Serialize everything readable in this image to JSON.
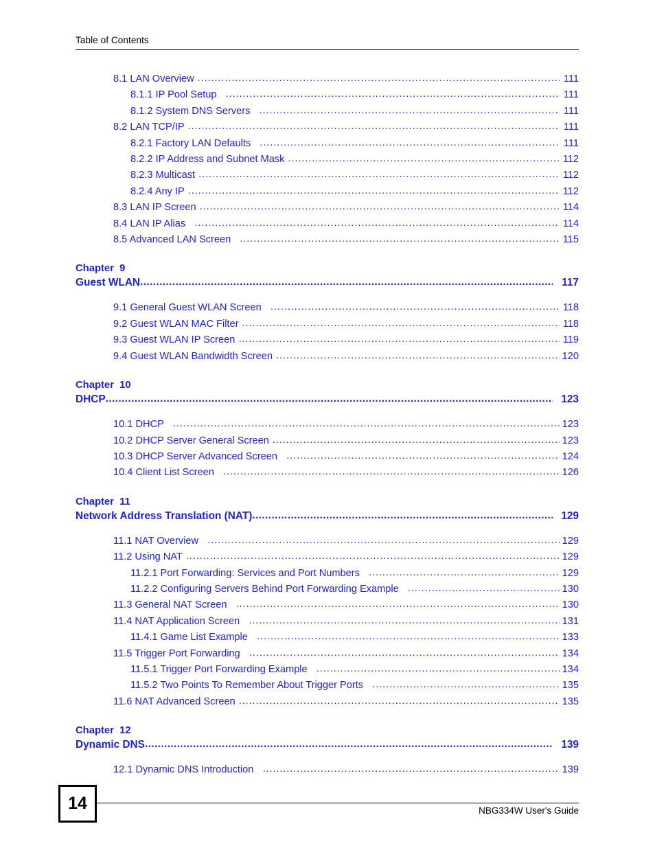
{
  "header": {
    "title": "Table of Contents"
  },
  "dot_leader": "..............................................................................................................................................................................",
  "colors": {
    "toc_blue": "#2222d6",
    "text_black": "#000000"
  },
  "toc": {
    "section_8": [
      {
        "label": "8.1 LAN Overview",
        "page": "111",
        "level": 1,
        "gap": "sm"
      },
      {
        "label": "8.1.1 IP Pool Setup",
        "page": "111",
        "level": 2,
        "gap": "md"
      },
      {
        "label": "8.1.2 System DNS Servers",
        "page": "111",
        "level": 2,
        "gap": "md"
      },
      {
        "label": "8.2 LAN TCP/IP",
        "page": "111",
        "level": 1,
        "gap": "sm"
      },
      {
        "label": "8.2.1 Factory LAN Defaults",
        "page": "111",
        "level": 2,
        "gap": "md"
      },
      {
        "label": "8.2.2 IP Address and Subnet Mask",
        "page": "112",
        "level": 2,
        "gap": "sm"
      },
      {
        "label": "8.2.3 Multicast",
        "page": "112",
        "level": 2,
        "gap": "sm"
      },
      {
        "label": "8.2.4 Any IP",
        "page": "112",
        "level": 2,
        "gap": "sm"
      },
      {
        "label": "8.3 LAN IP Screen",
        "page": "114",
        "level": 1,
        "gap": "sm"
      },
      {
        "label": "8.4 LAN IP Alias",
        "page": "114",
        "level": 1,
        "gap": "md"
      },
      {
        "label": "8.5 Advanced LAN Screen",
        "page": "115",
        "level": 1,
        "gap": "md"
      }
    ],
    "chapter_9": {
      "number": "Chapter  9",
      "title": "Guest WLAN",
      "page": "117",
      "entries": [
        {
          "label": "9.1 General Guest WLAN Screen",
          "page": "118",
          "level": 1,
          "gap": "md"
        },
        {
          "label": "9.2 Guest WLAN MAC Filter",
          "page": "118",
          "level": 1,
          "gap": "sm"
        },
        {
          "label": "9.3 Guest WLAN IP Screen",
          "page": "119",
          "level": 1,
          "gap": "sm"
        },
        {
          "label": "9.4 Guest WLAN Bandwidth Screen",
          "page": "120",
          "level": 1,
          "gap": "sm"
        }
      ]
    },
    "chapter_10": {
      "number": "Chapter  10",
      "title": "DHCP",
      "page": "123",
      "entries": [
        {
          "label": "10.1 DHCP",
          "page": "123",
          "level": 1,
          "gap": "md"
        },
        {
          "label": "10.2 DHCP Server General Screen",
          "page": "123",
          "level": 1,
          "gap": "sm"
        },
        {
          "label": "10.3 DHCP Server Advanced Screen",
          "page": "124",
          "level": 1,
          "gap": "md"
        },
        {
          "label": "10.4 Client List Screen",
          "page": "126",
          "level": 1,
          "gap": "md"
        }
      ]
    },
    "chapter_11": {
      "number": "Chapter  11",
      "title": "Network Address Translation (NAT)",
      "page": "129",
      "entries": [
        {
          "label": "11.1 NAT Overview",
          "page": "129",
          "level": 1,
          "gap": "md"
        },
        {
          "label": "11.2 Using NAT",
          "page": "129",
          "level": 1,
          "gap": "sm"
        },
        {
          "label": "11.2.1 Port Forwarding: Services and Port Numbers",
          "page": "129",
          "level": 2,
          "gap": "md"
        },
        {
          "label": "11.2.2 Configuring Servers Behind Port Forwarding Example",
          "page": "130",
          "level": 2,
          "gap": "md"
        },
        {
          "label": "11.3 General NAT Screen",
          "page": "130",
          "level": 1,
          "gap": "md"
        },
        {
          "label": "11.4 NAT Application Screen",
          "page": "131",
          "level": 1,
          "gap": "md"
        },
        {
          "label": "11.4.1 Game List Example",
          "page": "133",
          "level": 2,
          "gap": "md"
        },
        {
          "label": "11.5 Trigger Port Forwarding",
          "page": "134",
          "level": 1,
          "gap": "md"
        },
        {
          "label": "11.5.1 Trigger Port Forwarding Example",
          "page": "134",
          "level": 2,
          "gap": "md"
        },
        {
          "label": "11.5.2 Two Points To Remember About Trigger Ports",
          "page": "135",
          "level": 2,
          "gap": "md"
        },
        {
          "label": "11.6 NAT Advanced Screen",
          "page": "135",
          "level": 1,
          "gap": "sm"
        }
      ]
    },
    "chapter_12": {
      "number": "Chapter  12",
      "title": "Dynamic DNS",
      "page": "139",
      "entries": [
        {
          "label": "12.1 Dynamic DNS Introduction",
          "page": "139",
          "level": 1,
          "gap": "md"
        }
      ]
    }
  },
  "footer": {
    "page_number": "14",
    "guide_title": "NBG334W User's Guide"
  }
}
